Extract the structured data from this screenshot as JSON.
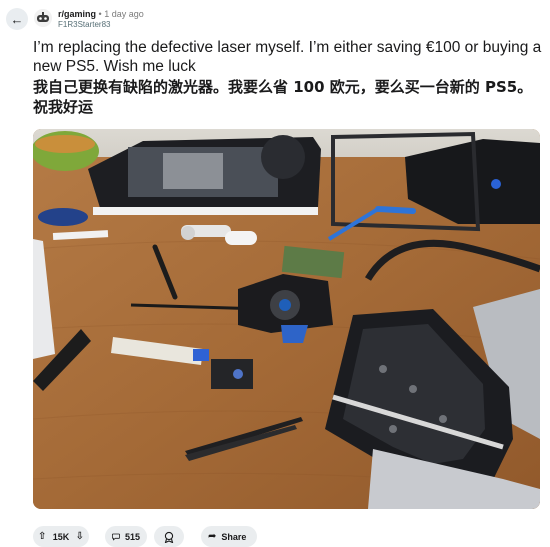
{
  "header": {
    "back_icon": "arrow-left-icon",
    "avatar_icon": "subreddit-avatar-icon",
    "subreddit": "r/gaming",
    "separator": "•",
    "time": "1 day ago",
    "author": "F1R3Starter83"
  },
  "post": {
    "title_en": "I’m replacing the defective laser myself. I’m either saving €100 or buying a new PS5. Wish me luck",
    "title_cn": "我自己更换有缺陷的激光器。我要么省 100 欧元，要么买一台新的 PS5。祝我好运"
  },
  "actions": {
    "upvote_icon": "upvote-arrow-icon",
    "downvote_icon": "downvote-arrow-icon",
    "score": "15K",
    "comment_icon": "comment-bubble-icon",
    "comments": "515",
    "award_icon": "award-icon",
    "share_icon": "share-arrow-icon",
    "share_label": "Share"
  },
  "colors": {
    "table_wood": "#a86f3e",
    "action_pill": "#eaedef",
    "meta_gray": "#576f76"
  }
}
